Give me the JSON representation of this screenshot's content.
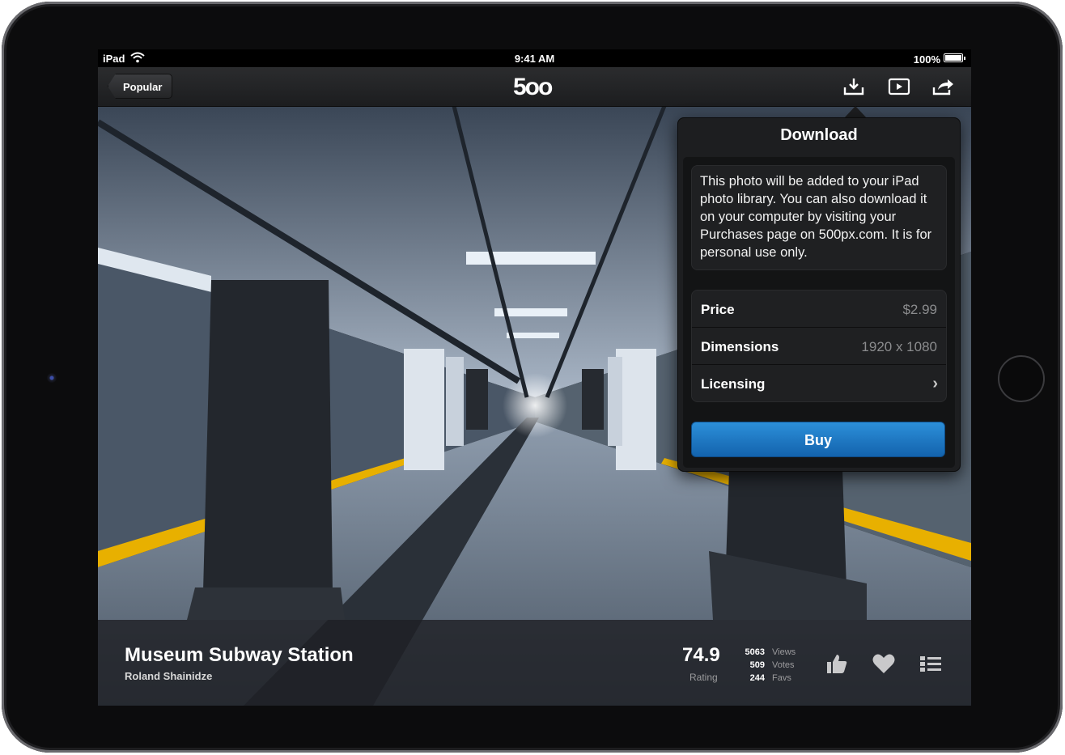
{
  "status_bar": {
    "carrier": "iPad",
    "time": "9:41 AM",
    "battery": "100%"
  },
  "nav": {
    "back_label": "Popular",
    "logo": "5oo",
    "actions": [
      "download-icon",
      "slideshow-icon",
      "share-icon"
    ]
  },
  "popover": {
    "title": "Download",
    "description": "This photo will be added to your iPad photo library. You can also download it on your computer by visiting your Purchases page on 500px.com. It is for personal use only.",
    "rows": [
      {
        "label": "Price",
        "value": "$2.99"
      },
      {
        "label": "Dimensions",
        "value": "1920 x 1080"
      },
      {
        "label": "Licensing",
        "value": ""
      }
    ],
    "buy_label": "Buy"
  },
  "photo": {
    "title": "Museum Subway Station",
    "photographer": "Roland Shainidze",
    "rating": "74.9",
    "rating_label": "Rating",
    "stats": [
      {
        "value": "5063",
        "label": "Views"
      },
      {
        "value": "509",
        "label": "Votes"
      },
      {
        "value": "244",
        "label": "Favs"
      }
    ]
  },
  "colors": {
    "accent": "#1f7cc9",
    "platform_stripe": "#e8b000"
  }
}
